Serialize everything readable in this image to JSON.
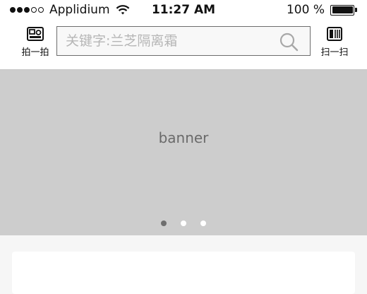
{
  "status_bar": {
    "carrier": "Applidium",
    "time": "11:27 AM",
    "battery_percent": "100 %",
    "signal_strength": "3 of 5",
    "battery_level": 1.0
  },
  "header": {
    "left_button_label": "拍一拍",
    "right_button_label": "扫一扫",
    "search": {
      "placeholder": "关键字:兰芝隔离霜",
      "value": ""
    }
  },
  "banner": {
    "label": "banner",
    "pages": 3,
    "active_page": 1
  },
  "colors": {
    "banner_bg": "#cdcdcd",
    "page_bg": "#f6f6f6",
    "pager_active": "#6e6e6e",
    "pager_inactive": "#ffffff"
  },
  "icons": {
    "left_button": "camera-icon",
    "right_button": "scan-icon",
    "search": "search-icon",
    "wifi": "wifi-icon"
  }
}
